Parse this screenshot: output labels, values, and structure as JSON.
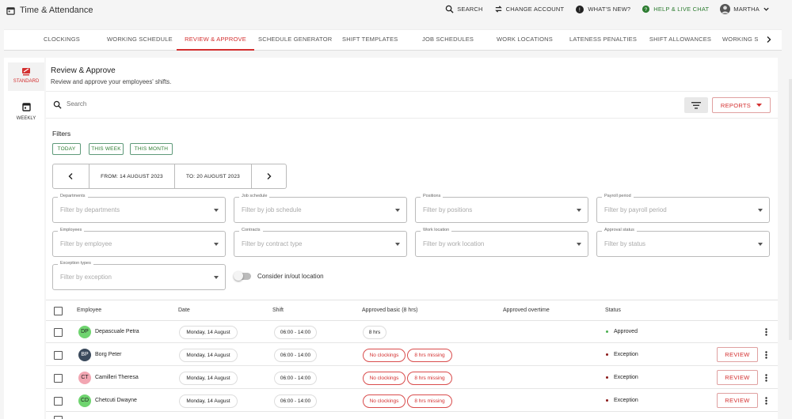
{
  "app": {
    "title": "Time & Attendance"
  },
  "topbar": {
    "search": "SEARCH",
    "change_account": "CHANGE ACCOUNT",
    "whats_new": "WHAT'S NEW?",
    "help": "HELP & LIVE CHAT",
    "user": "MARTHA"
  },
  "tabs": [
    "CLOCKINGS",
    "WORKING SCHEDULE",
    "REVIEW & APPROVE",
    "SCHEDULE GENERATOR",
    "SHIFT TEMPLATES",
    "JOB SCHEDULES",
    "WORK LOCATIONS",
    "LATENESS PENALTIES",
    "SHIFT ALLOWANCES",
    "WORKING SC"
  ],
  "active_tab": "REVIEW & APPROVE",
  "rail": {
    "standard": "STANDARD",
    "weekly": "WEEKLY"
  },
  "page": {
    "title": "Review & Approve",
    "subtitle": "Review and approve your employees' shifts."
  },
  "search": {
    "placeholder": "Search"
  },
  "reports_label": "REPORTS",
  "filters": {
    "title": "Filters",
    "chips": {
      "today": "TODAY",
      "this_week": "THIS WEEK",
      "this_month": "THIS MONTH"
    },
    "from": "FROM: 14 AUGUST 2023",
    "to": "TO: 20 AUGUST 2023",
    "fields": {
      "departments": {
        "label": "Departments",
        "placeholder": "Filter by departments"
      },
      "job_schedule": {
        "label": "Job schedule",
        "placeholder": "Filter by job schedule"
      },
      "positions": {
        "label": "Positions",
        "placeholder": "Filter by positions"
      },
      "payroll_period": {
        "label": "Payroll period",
        "placeholder": "Filter by payroll period"
      },
      "employees": {
        "label": "Employees",
        "placeholder": "Filter by employee"
      },
      "contracts": {
        "label": "Contracts",
        "placeholder": "Filter by contract type"
      },
      "work_location": {
        "label": "Work location",
        "placeholder": "Filter by work location"
      },
      "approval_status": {
        "label": "Approval status",
        "placeholder": "Filter by status"
      },
      "exception_types": {
        "label": "Exception types",
        "placeholder": "Filter by exception"
      }
    },
    "toggle_label": "Consider in/out location"
  },
  "table": {
    "headers": {
      "employee": "Employee",
      "date": "Date",
      "shift": "Shift",
      "approved_basic": "Approved basic (8 hrs)",
      "approved_overtime": "Approved overtime",
      "status": "Status"
    },
    "rows": [
      {
        "initials": "DP",
        "name": "Depascuale Petra",
        "date": "Monday, 14 August",
        "shift": "06:00 - 14:00",
        "basic": "8 hrs",
        "status": "Approved",
        "avatar_color": "#6fd46f"
      },
      {
        "initials": "BP",
        "name": "Borg Peter",
        "date": "Monday, 14 August",
        "shift": "06:00 - 14:00",
        "tag1": "No clockings",
        "tag2": "8 hrs missing",
        "status": "Exception",
        "review": "REVIEW",
        "avatar_color": "#3b4a5c"
      },
      {
        "initials": "CT",
        "name": "Camilleri Theresa",
        "date": "Monday, 14 August",
        "shift": "06:00 - 14:00",
        "tag1": "No clockings",
        "tag2": "8 hrs missing",
        "status": "Exception",
        "review": "REVIEW",
        "avatar_color": "#f2a6b2"
      },
      {
        "initials": "CD",
        "name": "Chetcuti Dwayne",
        "date": "Monday, 14 August",
        "shift": "06:00 - 14:00",
        "tag1": "No clockings",
        "tag2": "8 hrs missing",
        "status": "Exception",
        "review": "REVIEW",
        "avatar_color": "#6fd46f"
      }
    ]
  },
  "colors": {
    "accent": "#d32f2f",
    "green": "#2e7d32",
    "approved_dot": "#4caf50",
    "exception_dot": "#8b1a1a"
  }
}
